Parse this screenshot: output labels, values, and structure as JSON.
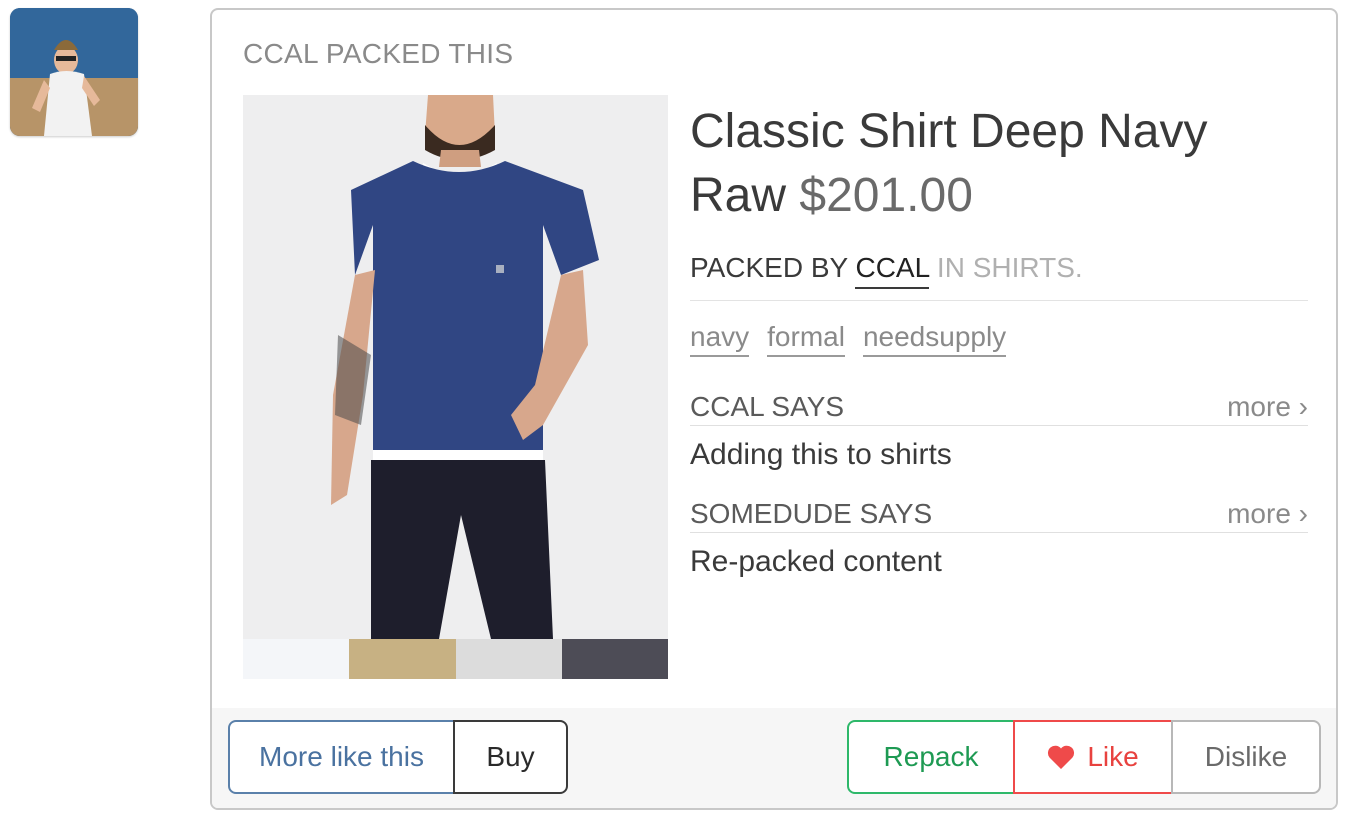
{
  "avatar": {
    "alt": "user avatar"
  },
  "card": {
    "header": "CCAL PACKED THIS",
    "product": {
      "title": "Classic Shirt Deep Navy Raw",
      "price": "$201.00"
    },
    "packed_by": {
      "prefix": "PACKED BY",
      "user": "CCAL",
      "category": "IN SHIRTS."
    },
    "tags": [
      "navy",
      "formal",
      "needsupply"
    ],
    "comments": [
      {
        "who": "CCAL SAYS",
        "more": "more ›",
        "text": "Adding this to shirts"
      },
      {
        "who": "SOMEDUDE SAYS",
        "more": "more ›",
        "text": "Re-packed content"
      }
    ],
    "swatches": [
      "#f4f6f9",
      "#c7b183",
      "#dcdcdc",
      "#4d4c56"
    ],
    "actions": {
      "more_like_this": "More like this",
      "buy": "Buy",
      "repack": "Repack",
      "like": "Like",
      "dislike": "Dislike"
    }
  }
}
